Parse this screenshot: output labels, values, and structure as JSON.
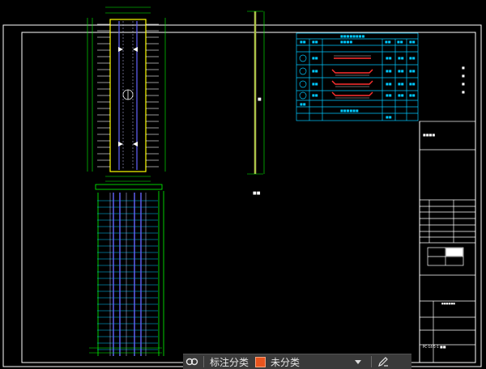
{
  "toolbar": {
    "annotation_layer_label": "标注分类",
    "category_value": "未分类",
    "category_color": "#e8541e",
    "left_icon": "link-rings-icon",
    "right_icon": "edit-pencil-icon"
  },
  "drawing": {
    "background": "#000000",
    "frame_color": "#ffffff",
    "accent_colors": [
      "#00ff00",
      "#00c8ff",
      "#ffff00",
      "#6464ff",
      "#ff3030"
    ]
  }
}
